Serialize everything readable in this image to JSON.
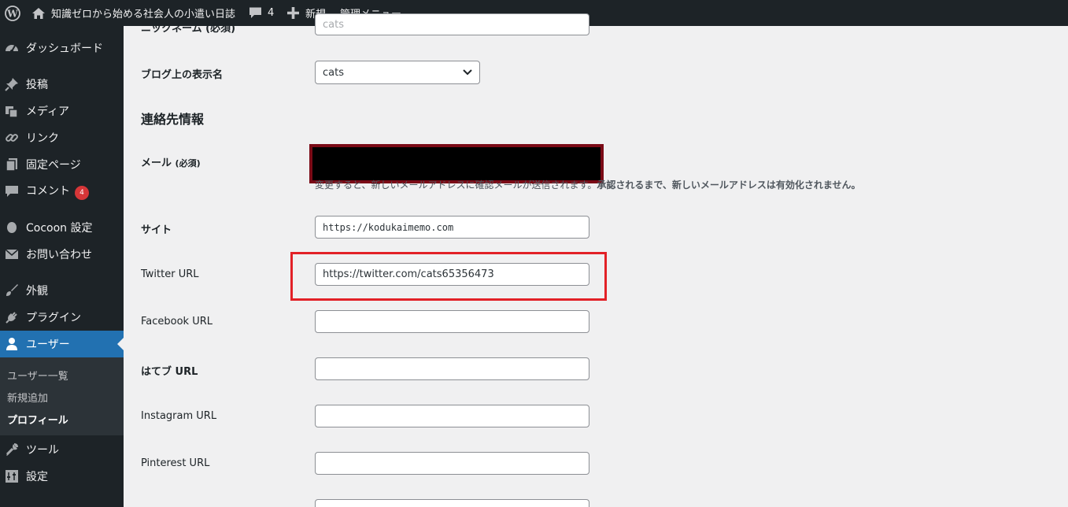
{
  "admin_bar": {
    "site_title": "知識ゼロから始める社会人の小遣い日誌",
    "comment_count": "4",
    "new_label": "新規",
    "admin_menu_label": "管理メニュー"
  },
  "sidebar": {
    "items": [
      {
        "label": "ダッシュボード",
        "icon": "dashboard-icon"
      },
      {
        "label": "投稿",
        "icon": "pin-icon"
      },
      {
        "label": "メディア",
        "icon": "media-icon"
      },
      {
        "label": "リンク",
        "icon": "link-icon"
      },
      {
        "label": "固定ページ",
        "icon": "page-icon"
      },
      {
        "label": "コメント",
        "icon": "comment-icon",
        "badge": "4"
      },
      {
        "label": "Cocoon 設定",
        "icon": "cocoon-icon"
      },
      {
        "label": "お問い合わせ",
        "icon": "mail-icon"
      },
      {
        "label": "外観",
        "icon": "brush-icon"
      },
      {
        "label": "プラグイン",
        "icon": "plugin-icon"
      },
      {
        "label": "ユーザー",
        "icon": "user-icon",
        "current": true
      },
      {
        "label": "ツール",
        "icon": "wrench-icon"
      },
      {
        "label": "設定",
        "icon": "settings-icon"
      }
    ],
    "users_submenu": [
      {
        "label": "ユーザー一覧"
      },
      {
        "label": "新規追加"
      },
      {
        "label": "プロフィール",
        "active": true
      }
    ]
  },
  "form": {
    "nickname": {
      "label": "ニックネーム (必須)",
      "value": "cats"
    },
    "display_name": {
      "label": "ブログ上の表示名",
      "value": "cats"
    },
    "contact_heading": "連絡先情報",
    "email": {
      "label": "メール",
      "required": "(必須)",
      "note": "変更すると、新しいメールアドレスに確認メールが送信されます。",
      "note_bold": "承認されるまで、新しいメールアドレスは有効化されません。"
    },
    "site": {
      "label": "サイト",
      "value": "https://kodukaimemo.com"
    },
    "twitter": {
      "label": "Twitter URL",
      "value": "https://twitter.com/cats65356473"
    },
    "facebook": {
      "label": "Facebook URL",
      "value": ""
    },
    "hatena": {
      "label": "はてブ URL",
      "value": ""
    },
    "instagram": {
      "label": "Instagram URL",
      "value": ""
    },
    "pinterest": {
      "label": "Pinterest URL",
      "value": ""
    }
  },
  "colors": {
    "admin_bg": "#1d2327",
    "current_menu": "#2271b1",
    "highlight_box": "#e22127",
    "redaction_border": "#7a0a16"
  }
}
